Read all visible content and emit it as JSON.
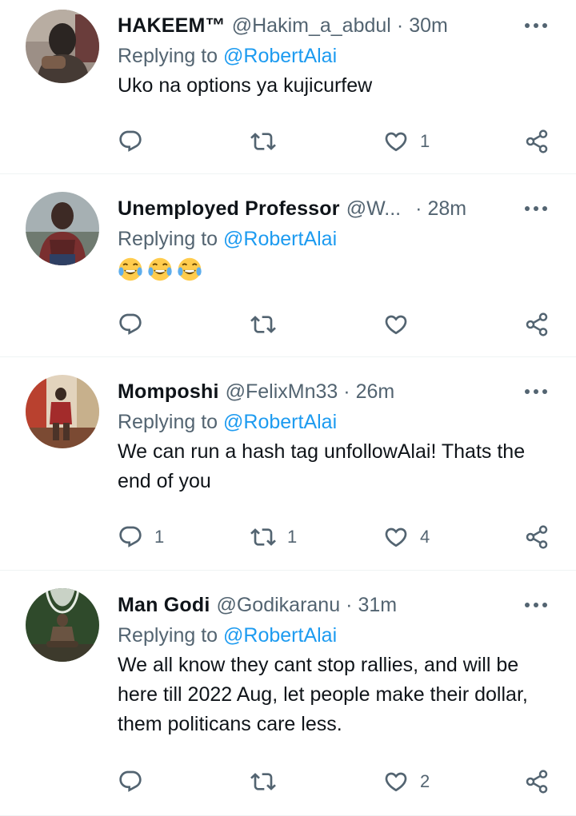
{
  "tweets": [
    {
      "name": "HAKEEM™",
      "handle": "@Hakim_a_abdul",
      "separator": "·",
      "time": "30m",
      "replying_prefix": "Replying to",
      "replying_to": "@RobertAlai",
      "text": "Uko na options ya kujicurfew",
      "replies": "",
      "retweets": "",
      "likes": "1",
      "avatar_colors": [
        "#6b5a4e",
        "#2b2522",
        "#c9b9a6"
      ]
    },
    {
      "name": "Unemployed Professor",
      "handle": "@W...",
      "separator": "·",
      "time": "28m",
      "replying_prefix": "Replying to",
      "replying_to": "@RobertAlai",
      "text": "",
      "emoji_count": 3,
      "replies": "",
      "retweets": "",
      "likes": "",
      "avatar_colors": [
        "#8e9aa0",
        "#3d2a25",
        "#7a2f2f"
      ]
    },
    {
      "name": "Momposhi",
      "handle": "@FelixMn33",
      "separator": "·",
      "time": "26m",
      "replying_prefix": "Replying to",
      "replying_to": "@RobertAlai",
      "text": "We can run a hash tag unfollowAlai! Thats the end of you",
      "replies": "1",
      "retweets": "1",
      "likes": "4",
      "avatar_colors": [
        "#d8c3a5",
        "#a32b2b",
        "#5b3b2a"
      ]
    },
    {
      "name": "Man Godi",
      "handle": "@Godikaranu",
      "separator": "·",
      "time": "31m",
      "replying_prefix": "Replying to",
      "replying_to": "@RobertAlai",
      "text": "We all know they cant stop rallies, and will be here till 2022 Aug, let people make their dollar, them politicans care less.",
      "replies": "",
      "retweets": "",
      "likes": "2",
      "avatar_colors": [
        "#2f4a2b",
        "#a7b3a4",
        "#5b4636"
      ]
    }
  ],
  "colors": {
    "text": "#0f1419",
    "secondary": "#536471",
    "link": "#1d9bf0",
    "divider": "#eff3f4"
  },
  "icons": [
    "reply-icon",
    "retweet-icon",
    "like-icon",
    "share-icon",
    "more-icon"
  ]
}
